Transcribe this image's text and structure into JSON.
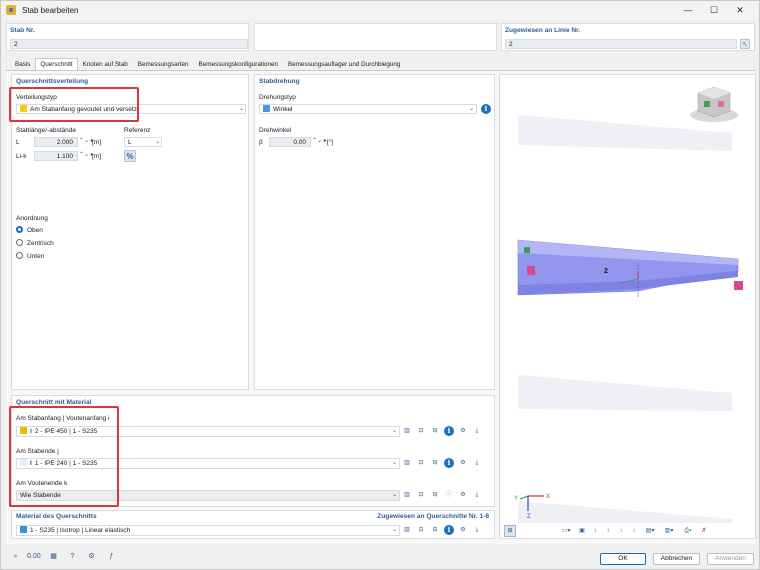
{
  "window": {
    "title": "Stab bearbeiten",
    "min": "—",
    "max": "☐",
    "close": "✕"
  },
  "top": {
    "stab_nr_label": "Stab Nr.",
    "stab_nr_value": "2",
    "linie_label": "Zugewiesen an Linie Nr.",
    "linie_value": "2"
  },
  "tabs": [
    "Basis",
    "Querschnitt",
    "Knoten auf Stab",
    "Bemessungsarten",
    "Bemessungskonfigurationen",
    "Bemessungsauflager und Durchbiegung"
  ],
  "active_tab": "Querschnitt",
  "verteilung": {
    "header": "Querschnittsverteilung",
    "typ_label": "Verteilungstyp",
    "typ_value": "Am Stabanfang gevoutet und versetzt",
    "typ_color": "#f2d20f",
    "stablaenge_label": "Stablänge/-abstände",
    "referenz_label": "Referenz",
    "row1": {
      "name": "L",
      "value": "2.000",
      "unit": "[m]",
      "ref": "L"
    },
    "row2": {
      "name": "Li-k",
      "value": "1.100",
      "unit": "[m]",
      "ref_icon": "%"
    },
    "anordnung_label": "Anordnung",
    "options": [
      "Oben",
      "Zentrisch",
      "Unten"
    ],
    "selected": "Oben"
  },
  "drehung": {
    "header": "Stabdrehung",
    "typ_label": "Drehungstyp",
    "typ_value": "Winkel",
    "typ_color": "#4f95d9",
    "winkel_label": "Drehwinkel",
    "beta_symbol": "β",
    "beta_value": "0.00",
    "beta_unit": "[°]"
  },
  "material_section": {
    "header": "Querschnitt mit Material",
    "anfang_label": "Am Stabanfang | Voutenanfang i",
    "anfang_value": "2 - IPE 450 | 1 - S235",
    "anfang_color": "#f2b800",
    "ende_label": "Am Stabende j",
    "ende_value": "1 - IPE 240 | 1 - S235",
    "ende_color": "#e8eef7",
    "vouten_label": "Am Voutenende k",
    "vouten_value": "Wie Stabende"
  },
  "material": {
    "header": "Material des Querschnitts",
    "assigned_label": "Zugewiesen an Querschnitte Nr. 1-8",
    "value": "1 - S235 | Isotrop | Linear elastisch",
    "color": "#3a8fd6"
  },
  "viewer": {
    "member_label": "2",
    "axis_x": "X",
    "axis_y": "Y",
    "axis_z": "Z"
  },
  "footer": {
    "ok": "OK",
    "cancel": "Abbrechen",
    "apply": "Anwenden"
  },
  "colors": {
    "accent": "#2e5e96",
    "highlight": "#d9363e",
    "beam": "#8f93f0"
  }
}
